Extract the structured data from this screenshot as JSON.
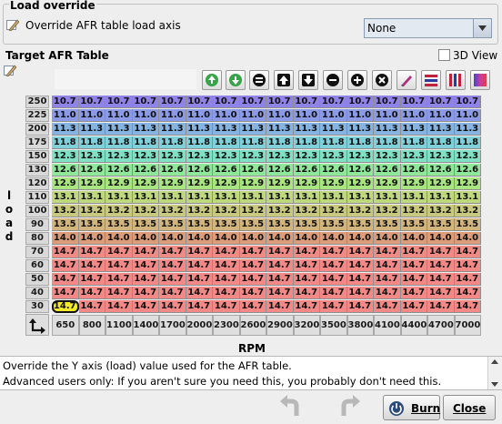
{
  "override": {
    "group_title": "Load override",
    "checkbox_label": "Override AFR table load axis",
    "axis_select_value": "None"
  },
  "table": {
    "title": "Target AFR Table",
    "view3d_label": "3D View",
    "y_axis_label": "load",
    "x_axis_label": "RPM",
    "load_values": [
      "250",
      "225",
      "200",
      "175",
      "150",
      "130",
      "120",
      "110",
      "100",
      "90",
      "80",
      "70",
      "60",
      "50",
      "40",
      "30"
    ],
    "rpm_values": [
      "650",
      "800",
      "1100",
      "1400",
      "1700",
      "2000",
      "2300",
      "2600",
      "2900",
      "3200",
      "3500",
      "3800",
      "4100",
      "4400",
      "4700",
      "7000"
    ],
    "row_afr": [
      "10.7",
      "11.0",
      "11.3",
      "11.8",
      "12.3",
      "12.6",
      "12.9",
      "13.1",
      "13.2",
      "13.5",
      "14.0",
      "14.7",
      "14.7",
      "14.7",
      "14.7",
      "14.7"
    ],
    "selected_cell": {
      "row": 15,
      "col": 0
    },
    "row_colors": [
      "#8f83e8",
      "#8a9ae6",
      "#85b4e2",
      "#80d0d9",
      "#7fe0c4",
      "#8fe79a",
      "#a8e47f",
      "#bfd87e",
      "#c8c97e",
      "#d2b57d",
      "#dc9c7a",
      "#ef8a85",
      "#f28986",
      "#f28986",
      "#f28986",
      "#f28986"
    ]
  },
  "toolbar": {
    "icons": [
      "increment-green-icon",
      "decrement-green-icon",
      "equals-icon",
      "arrow-up-icon",
      "arrow-down-icon",
      "minus-icon",
      "plus-icon",
      "clear-icon",
      "pencil-icon",
      "rows-color-icon",
      "columns-color-icon",
      "gradient-color-icon"
    ]
  },
  "description": {
    "line1": "Override the Y axis (load) value used for the AFR table.",
    "line2": "Advanced users only: If you aren't sure you need this, you probably don't need this."
  },
  "buttons": {
    "burn_label": "Burn",
    "close_label": "Close"
  }
}
